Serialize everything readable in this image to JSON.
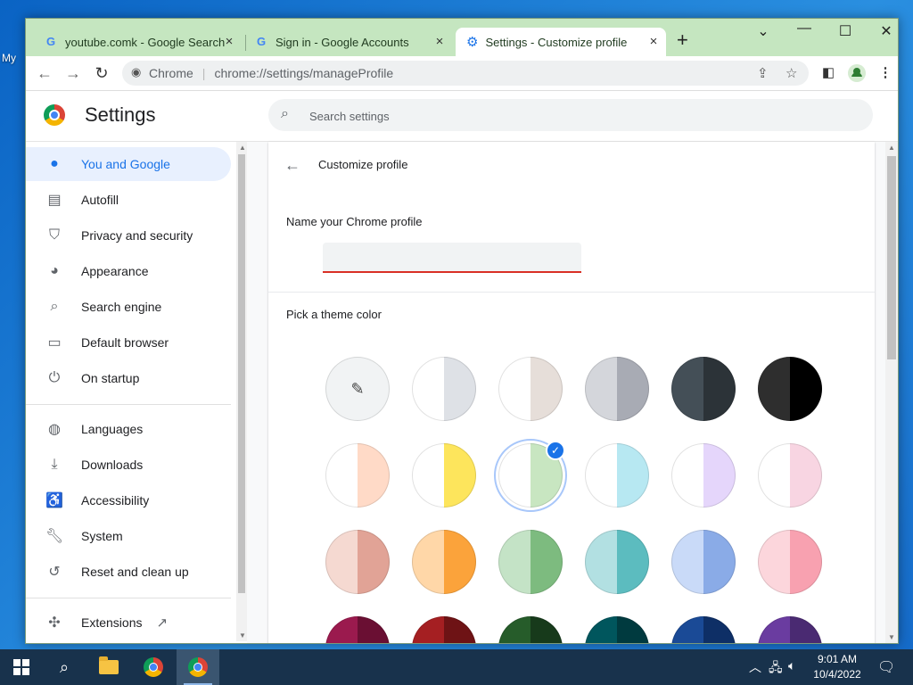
{
  "tabs": [
    {
      "title": "youtube.comk - Google Search",
      "close": "×",
      "icon": "google-g-icon"
    },
    {
      "title": "Sign in - Google Accounts",
      "close": "×",
      "icon": "google-g-icon"
    },
    {
      "title": "Settings - Customize profile",
      "close": "×",
      "icon": "settings-gear-icon",
      "active": true
    }
  ],
  "new_tab_symbol": "+",
  "window_controls": {
    "dropdown": "⌄",
    "minimize": "—",
    "maximize": "☐",
    "close": "✕"
  },
  "toolbar": {
    "back": "←",
    "forward": "→",
    "reload": "↻",
    "site_label": "Chrome",
    "url": "chrome://settings/manageProfile"
  },
  "settings": {
    "title": "Settings",
    "search_placeholder": "Search settings"
  },
  "sidebar": {
    "items": [
      {
        "label": "You and Google",
        "icon": "person-icon",
        "active": true
      },
      {
        "label": "Autofill",
        "icon": "clipboard-icon"
      },
      {
        "label": "Privacy and security",
        "icon": "shield-icon"
      },
      {
        "label": "Appearance",
        "icon": "palette-icon"
      },
      {
        "label": "Search engine",
        "icon": "search-icon"
      },
      {
        "label": "Default browser",
        "icon": "browser-window-icon"
      },
      {
        "label": "On startup",
        "icon": "power-icon"
      },
      {
        "label": "Languages",
        "icon": "globe-icon"
      },
      {
        "label": "Downloads",
        "icon": "download-icon"
      },
      {
        "label": "Accessibility",
        "icon": "accessibility-icon"
      },
      {
        "label": "System",
        "icon": "wrench-icon"
      },
      {
        "label": "Reset and clean up",
        "icon": "history-icon"
      },
      {
        "label": "Extensions",
        "icon": "puzzle-icon",
        "external": "open-in-new-icon"
      }
    ]
  },
  "main": {
    "back_arrow": "←",
    "title": "Customize profile",
    "name_label": "Name your Chrome profile",
    "name_value": "",
    "theme_label": "Pick a theme color",
    "swatches": [
      {
        "name": "custom-color-picker",
        "left": "#f1f3f4",
        "right": "#f1f3f4",
        "picker": true
      },
      {
        "name": "default",
        "left": "#ffffff",
        "right": "#dee1e6"
      },
      {
        "name": "beige",
        "left": "#ffffff",
        "right": "#e6ded9"
      },
      {
        "name": "grey",
        "left": "#d4d6db",
        "right": "#a8abb4"
      },
      {
        "name": "slate",
        "left": "#444f57",
        "right": "#2c3338"
      },
      {
        "name": "black",
        "left": "#2e2e2e",
        "right": "#000000"
      },
      {
        "name": "peach",
        "left": "#ffffff",
        "right": "#ffdac7"
      },
      {
        "name": "yellow",
        "left": "#ffffff",
        "right": "#fde55c"
      },
      {
        "name": "light-green",
        "left": "#ffffff",
        "right": "#c8e6c1",
        "selected": true
      },
      {
        "name": "light-cyan",
        "left": "#ffffff",
        "right": "#b7e8f2"
      },
      {
        "name": "lavender",
        "left": "#ffffff",
        "right": "#e5d6fb"
      },
      {
        "name": "light-pink",
        "left": "#ffffff",
        "right": "#f8d5e2"
      },
      {
        "name": "rose",
        "left": "#f5d9d1",
        "right": "#e1a396"
      },
      {
        "name": "orange",
        "left": "#ffd7a8",
        "right": "#fba33b"
      },
      {
        "name": "green",
        "left": "#c4e3c6",
        "right": "#7dbb7f"
      },
      {
        "name": "teal",
        "left": "#b2e0e2",
        "right": "#5cbcbf"
      },
      {
        "name": "blue",
        "left": "#c9daf8",
        "right": "#8aabe7"
      },
      {
        "name": "pink",
        "left": "#fcd6dc",
        "right": "#f8a1b0"
      },
      {
        "name": "magenta",
        "left": "#9b1a4e",
        "right": "#6a0f33"
      },
      {
        "name": "red",
        "left": "#a51f22",
        "right": "#6e1315"
      },
      {
        "name": "dark-green",
        "left": "#265c2a",
        "right": "#173a1b"
      },
      {
        "name": "dark-teal",
        "left": "#00565d",
        "right": "#003a3f"
      },
      {
        "name": "navy",
        "left": "#1a4a96",
        "right": "#0e2f66"
      },
      {
        "name": "purple",
        "left": "#6a3ca0",
        "right": "#4a2a72"
      }
    ]
  },
  "taskbar": {
    "time": "9:01 AM",
    "date": "10/4/2022"
  },
  "colors": {
    "accent": "#1a73e8",
    "tabstrip": "#c5e6c0",
    "error_underline": "#d93025",
    "taskbar": "#18324c"
  }
}
